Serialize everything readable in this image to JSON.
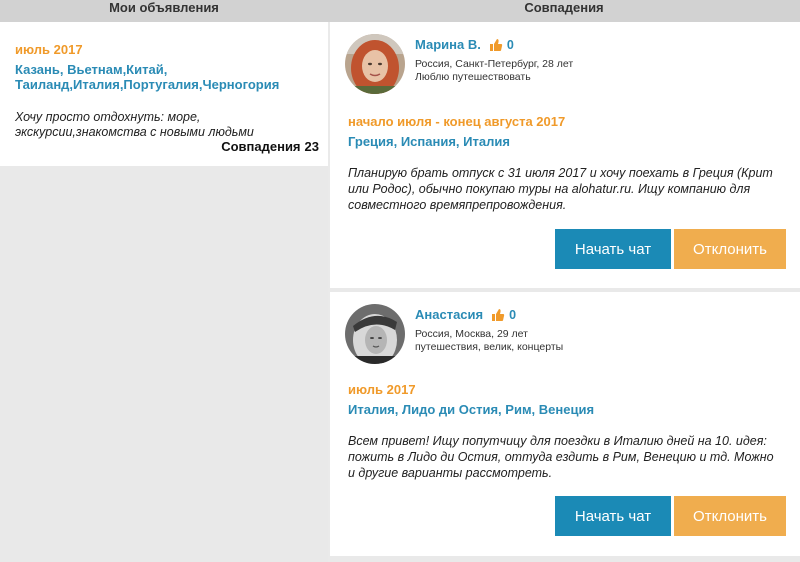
{
  "header": {
    "left_title": "Мои объявления",
    "right_title": "Совпадения"
  },
  "my_ad": {
    "date": "июль 2017",
    "places_line1": "Казань, Вьетнам,Китай,",
    "places_line2": "Таиланд,Италия,Португалия,Черногория",
    "description": "Хочу просто отдохнуть: море, экскурсии,знакомства с новыми людьми",
    "matches_label": "Совпадения",
    "matches_count": "23"
  },
  "matches": [
    {
      "name": "Марина В.",
      "likes": "0",
      "location": "Россия, Санкт-Петербург, 28 лет",
      "interests": "Люблю путешествовать",
      "date": "начало июля - конец августа 2017",
      "places": "Греция, Испания, Италия",
      "description": "Планирую брать отпуск с 31 июля 2017 и хочу поехать в Греция (Крит или Родос), обычно покупаю туры на alohatur.ru. Ищу компанию для совместного времяпрепровождения.",
      "chat_label": "Начать чат",
      "decline_label": "Отклонить"
    },
    {
      "name": "Анастасия",
      "likes": "0",
      "location": "Россия, Москва, 29 лет",
      "interests": "путешествия, велик, концерты",
      "date": "июль 2017",
      "places": "Италия, Лидо ди Остия, Рим, Венеция",
      "description": "Всем привет! Ищу попутчицу для поездки в Италию дней на 10. идея: пожить в Лидо ди Остия, оттуда ездить в Рим, Венецию и тд. Можно и другие варианты рассмотреть.",
      "chat_label": "Начать чат",
      "decline_label": "Отклонить"
    }
  ],
  "colors": {
    "accent_blue": "#2a8bb5",
    "accent_orange": "#f09a2a",
    "chat_button": "#1b8ab6",
    "decline_button": "#f0ad4e"
  },
  "icons": {
    "likes": "thumbs-up-icon"
  }
}
